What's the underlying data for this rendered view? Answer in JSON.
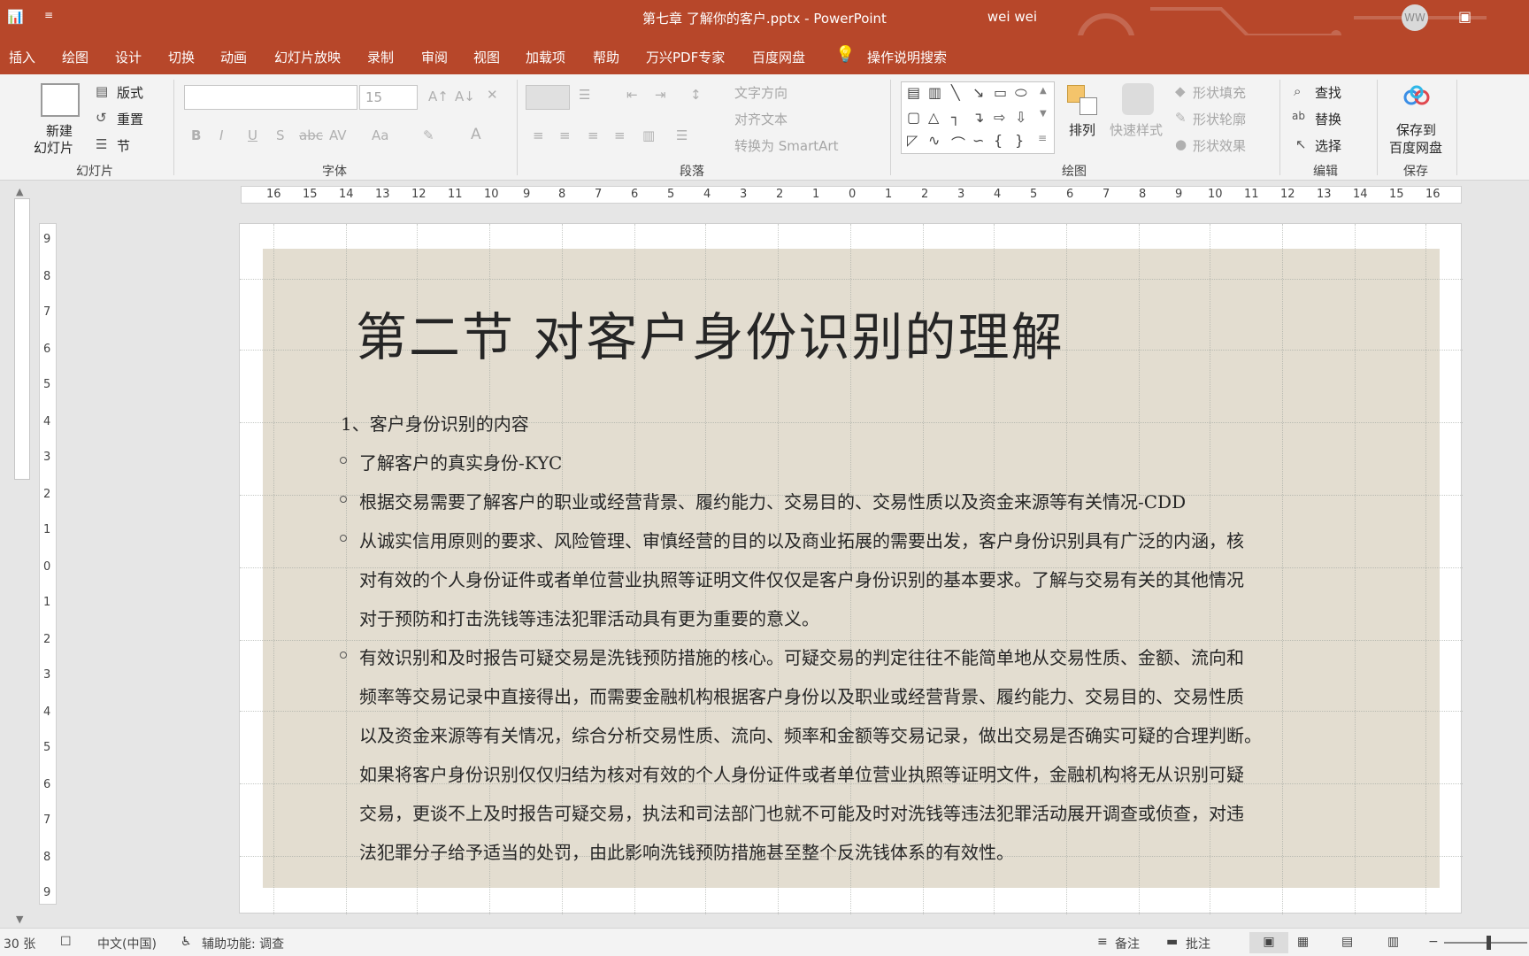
{
  "window": {
    "title": "第七章 了解你的客户.pptx - PowerPoint",
    "user_name": "wei wei",
    "avatar_initials": "WW",
    "accent_color": "#b7472a"
  },
  "menu_tabs": [
    "插入",
    "绘图",
    "设计",
    "切换",
    "动画",
    "幻灯片放映",
    "录制",
    "审阅",
    "视图",
    "加载项",
    "帮助",
    "万兴PDF专家",
    "百度网盘"
  ],
  "tell_me": "操作说明搜索",
  "ribbon": {
    "slides": {
      "new_slide_line1": "新建",
      "new_slide_line2": "幻灯片",
      "layout": "版式",
      "reset": "重置",
      "section": "节",
      "label": "幻灯片"
    },
    "font": {
      "font_size": "15",
      "label": "字体"
    },
    "paragraph": {
      "text_direction": "文字方向",
      "align_text": "对齐文本",
      "convert_smartart": "转换为 SmartArt",
      "label": "段落"
    },
    "drawing": {
      "arrange": "排列",
      "quick_styles": "快速样式",
      "shape_fill": "形状填充",
      "shape_outline": "形状轮廓",
      "shape_effects": "形状效果",
      "label": "绘图"
    },
    "editing": {
      "find": "查找",
      "replace": "替换",
      "select": "选择",
      "label": "编辑"
    },
    "save": {
      "save_to_line1": "保存到",
      "save_to_line2": "百度网盘",
      "label": "保存"
    }
  },
  "hruler_ticks": [
    "16",
    "15",
    "14",
    "13",
    "12",
    "11",
    "10",
    "9",
    "8",
    "7",
    "6",
    "5",
    "4",
    "3",
    "2",
    "1",
    "0",
    "1",
    "2",
    "3",
    "4",
    "5",
    "6",
    "7",
    "8",
    "9",
    "10",
    "11",
    "12",
    "13",
    "14",
    "15",
    "16"
  ],
  "vruler_ticks": [
    "9",
    "8",
    "7",
    "6",
    "5",
    "4",
    "3",
    "2",
    "1",
    "0",
    "1",
    "2",
    "3",
    "4",
    "5",
    "6",
    "7",
    "8",
    "9"
  ],
  "slide": {
    "title": "第二节  对客户身份识别的理解",
    "heading": "1、客户身份识别的内容",
    "lines": [
      "了解客户的真实身份-KYC",
      "根据交易需要了解客户的职业或经营背景、履约能力、交易目的、交易性质以及资金来源等有关情况-CDD",
      "从诚实信用原则的要求、风险管理、审慎经营的目的以及商业拓展的需要出发，客户身份识别具有广泛的内涵，核",
      "对有效的个人身份证件或者单位营业执照等证明文件仅仅是客户身份识别的基本要求。了解与交易有关的其他情况",
      "对于预防和打击洗钱等违法犯罪活动具有更为重要的意义。",
      "有效识别和及时报告可疑交易是洗钱预防措施的核心。可疑交易的判定往往不能简单地从交易性质、金额、流向和",
      "频率等交易记录中直接得出，而需要金融机构根据客户身份以及职业或经营背景、履约能力、交易目的、交易性质",
      "以及资金来源等有关情况，综合分析交易性质、流向、频率和金额等交易记录，做出交易是否确实可疑的合理判断。",
      "如果将客户身份识别仅仅归结为核对有效的个人身份证件或者单位营业执照等证明文件，金融机构将无从识别可疑",
      "交易，更谈不上及时报告可疑交易，执法和司法部门也就不可能及时对洗钱等违法犯罪活动展开调查或侦查，对违",
      "法犯罪分子给予适当的处罚，由此影响洗钱预防措施甚至整个反洗钱体系的有效性。"
    ],
    "background_color": "#e3ddd0"
  },
  "status": {
    "slide_count": "30 张",
    "language": "中文(中国)",
    "accessibility": "辅助功能: 调查",
    "notes": "备注",
    "comments": "批注"
  }
}
